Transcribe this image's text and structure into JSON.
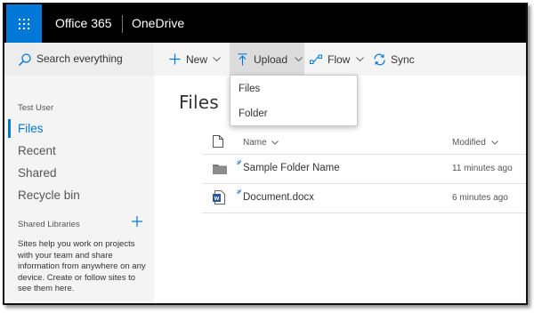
{
  "suitebar": {
    "brand": "Office 365",
    "app": "OneDrive"
  },
  "leftnav": {
    "search_label": "Search everything",
    "user": "Test User",
    "items": [
      {
        "label": "Files",
        "active": true
      },
      {
        "label": "Recent"
      },
      {
        "label": "Shared"
      },
      {
        "label": "Recycle bin"
      }
    ],
    "shared_libraries": {
      "heading": "Shared Libraries",
      "description": "Sites help you work on projects with your team and share information from anywhere on any device. Create or follow sites to see them here."
    }
  },
  "commandbar": {
    "new_label": "New",
    "upload_label": "Upload",
    "flow_label": "Flow",
    "sync_label": "Sync"
  },
  "upload_menu": {
    "items": [
      "Files",
      "Folder"
    ]
  },
  "main": {
    "title": "Files",
    "columns": {
      "name": "Name",
      "modified": "Modified"
    },
    "rows": [
      {
        "name": "Sample Folder Name",
        "modified": "11 minutes ago",
        "icon": "folder-icon"
      },
      {
        "name": "Document.docx",
        "modified": "6 minutes ago",
        "icon": "word-doc-icon"
      }
    ]
  },
  "colors": {
    "accent": "#0078d7",
    "suitebar": "#000000",
    "nav_bg": "#f4f4f4"
  }
}
